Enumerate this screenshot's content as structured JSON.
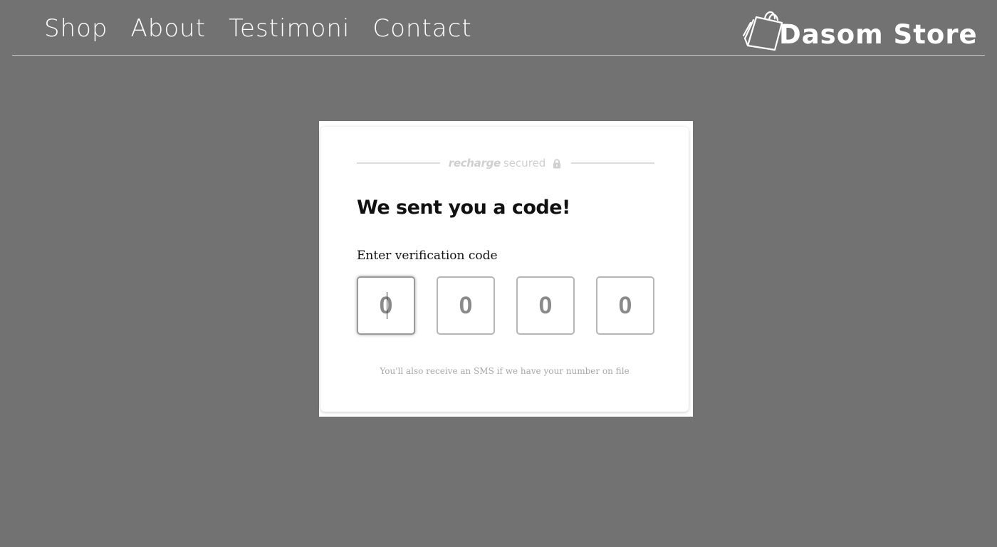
{
  "nav": {
    "items": [
      {
        "label": "Shop"
      },
      {
        "label": "About"
      },
      {
        "label": "Testimoni"
      },
      {
        "label": "Contact"
      }
    ]
  },
  "brand": {
    "name": "Dasom Store",
    "icon": "shopping-bag-icon"
  },
  "modal": {
    "secured_brand": "recharge",
    "secured_word": "secured",
    "lock_icon": "lock-icon",
    "title": "We sent you a code!",
    "code_label": "Enter verification code",
    "code_placeholders": [
      "0",
      "0",
      "0",
      "0"
    ],
    "sms_note": "You'll also receive an SMS if we have your number on file"
  },
  "colors": {
    "page_background": "#727272",
    "card_background": "#ffffff",
    "nav_text": "#ffffff",
    "muted_gray": "#cfcfcf"
  }
}
